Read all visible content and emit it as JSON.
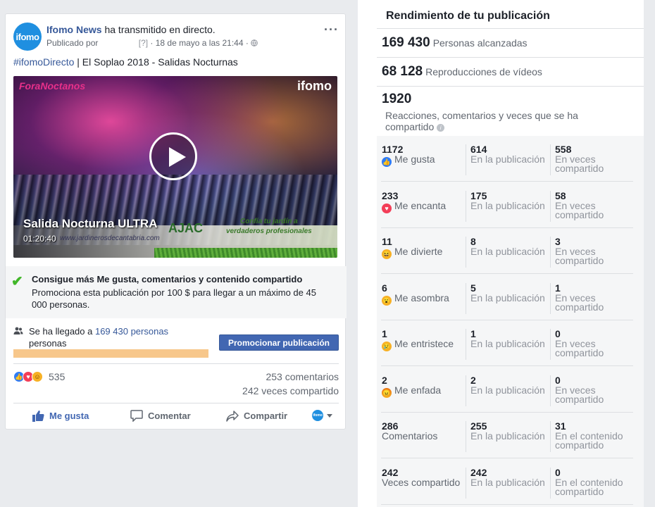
{
  "post": {
    "page_name": "Ifomo News",
    "action": " ha transmitido en directo.",
    "published_by": "Publicado por",
    "help_marker": "[?]",
    "date": "· 18 de mayo a las 21:44 ·",
    "more": "···",
    "logo_text": "ifomo",
    "hashtag": "#ifomoDirecto",
    "text_rest": " | El Soplao 2018 - Salidas Nocturnas",
    "video": {
      "overlay_title": "Salida Nocturna ULTRA",
      "duration": "01:20:40",
      "url": "www.jardinerosdecantabria.com",
      "brand_left": "ForaNoctanos",
      "brand_right": "ifomo",
      "sponsor": "AJAC",
      "slogan": "Confía tu jardín a\nverdaderos profesionales"
    },
    "promo": {
      "title": "Consigue más Me gusta, comentarios y contenido compartido",
      "description": "Promociona esta publicación por 100 $ para llegar a un máximo de 45 000 personas."
    },
    "reach": {
      "prefix": "Se ha llegado a ",
      "number": "169 430 personas",
      "suffix": "personas",
      "progress": 1.0,
      "button": "Promocionar publicación"
    },
    "reactions_count": "535",
    "comments": "253 comentarios",
    "shares": "242 veces compartido",
    "actions": {
      "like": "Me gusta",
      "comment": "Comentar",
      "share": "Compartir"
    }
  },
  "stats": {
    "title": "Rendimiento de tu publicación",
    "reached": {
      "num": "169 430",
      "label": "Personas alcanzadas"
    },
    "views": {
      "num": "68 128",
      "label": "Reproducciones de vídeos"
    },
    "engagement": {
      "num": "1920",
      "label": "Reacciones, comentarios y veces que se ha compartido"
    },
    "rows": [
      {
        "emoji": "like",
        "total": "1172",
        "label": "Me gusta",
        "on_post": "614",
        "on_post_label": "En la publicación",
        "shared": "558",
        "shared_label": "En veces compartido"
      },
      {
        "emoji": "love",
        "total": "233",
        "label": "Me encanta",
        "on_post": "175",
        "on_post_label": "En la publicación",
        "shared": "58",
        "shared_label": "En veces compartido"
      },
      {
        "emoji": "haha",
        "total": "11",
        "label": "Me divierte",
        "on_post": "8",
        "on_post_label": "En la publicación",
        "shared": "3",
        "shared_label": "En veces compartido"
      },
      {
        "emoji": "wow",
        "total": "6",
        "label": "Me asombra",
        "on_post": "5",
        "on_post_label": "En la publicación",
        "shared": "1",
        "shared_label": "En veces compartido"
      },
      {
        "emoji": "sad",
        "total": "1",
        "label": "Me entristece",
        "on_post": "1",
        "on_post_label": "En la publicación",
        "shared": "0",
        "shared_label": "En veces compartido"
      },
      {
        "emoji": "angry",
        "total": "2",
        "label": "Me enfada",
        "on_post": "2",
        "on_post_label": "En la publicación",
        "shared": "0",
        "shared_label": "En veces compartido"
      },
      {
        "emoji": "",
        "total": "286",
        "label": "Comentarios",
        "on_post": "255",
        "on_post_label": "En la publicación",
        "shared": "31",
        "shared_label": "En el contenido compartido"
      },
      {
        "emoji": "",
        "total": "242",
        "label": "Veces compartido",
        "on_post": "242",
        "on_post_label": "En la publicación",
        "shared": "0",
        "shared_label": "En el contenido compartido"
      }
    ]
  },
  "colors": {
    "link": "#365899",
    "button": "#4267b2",
    "progress": "#f7c78b",
    "check": "#42b72a"
  }
}
